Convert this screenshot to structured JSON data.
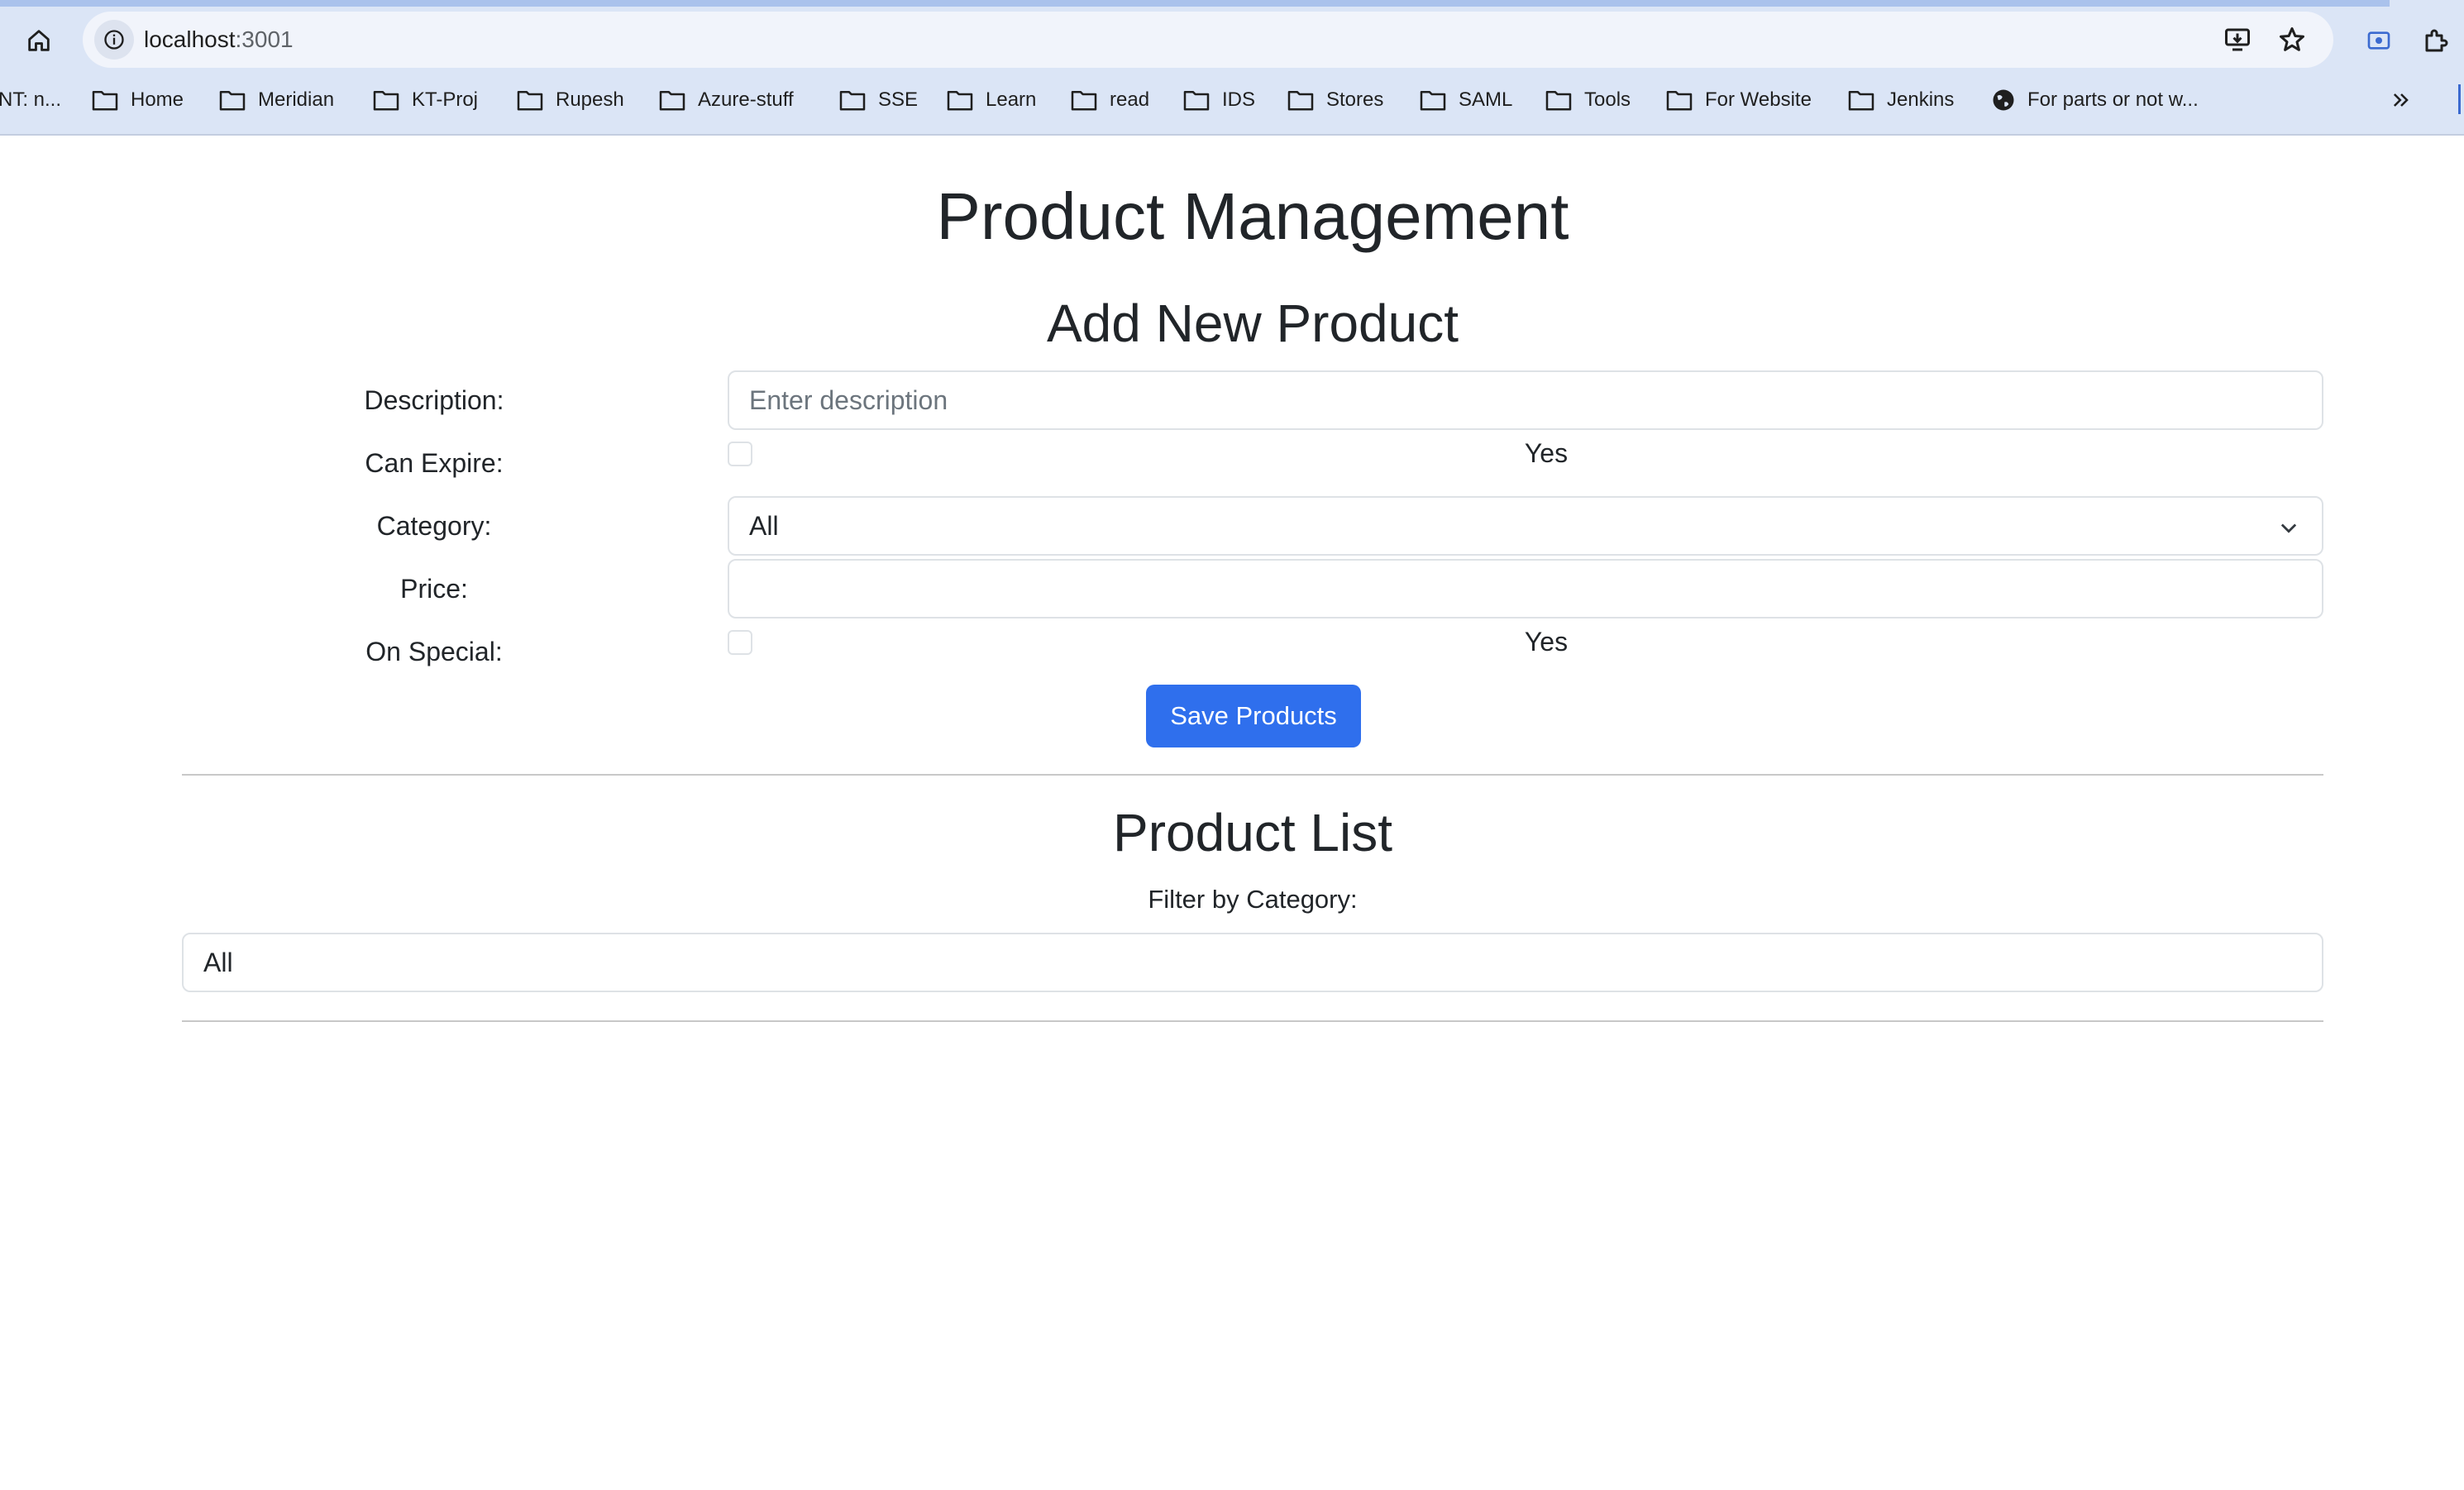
{
  "browser": {
    "url_host": "localhost",
    "url_port": ":3001",
    "bookmarks": [
      {
        "label": "NT: n...",
        "icon": "folder-icon"
      },
      {
        "label": "Home",
        "icon": "folder-icon"
      },
      {
        "label": "Meridian",
        "icon": "folder-icon"
      },
      {
        "label": "KT-Proj",
        "icon": "folder-icon"
      },
      {
        "label": "Rupesh",
        "icon": "folder-icon"
      },
      {
        "label": "Azure-stuff",
        "icon": "folder-icon"
      },
      {
        "label": "SSE",
        "icon": "folder-icon"
      },
      {
        "label": "Learn",
        "icon": "folder-icon"
      },
      {
        "label": "read",
        "icon": "folder-icon"
      },
      {
        "label": "IDS",
        "icon": "folder-icon"
      },
      {
        "label": "Stores",
        "icon": "folder-icon"
      },
      {
        "label": "SAML",
        "icon": "folder-icon"
      },
      {
        "label": "Tools",
        "icon": "folder-icon"
      },
      {
        "label": "For Website",
        "icon": "folder-icon"
      },
      {
        "label": "Jenkins",
        "icon": "folder-icon"
      },
      {
        "label": "For parts or not w...",
        "icon": "globe-icon"
      }
    ]
  },
  "page": {
    "title": "Product Management",
    "add_section_title": "Add New Product",
    "form": {
      "description_label": "Description:",
      "description_placeholder": "Enter description",
      "description_value": "",
      "can_expire_label": "Can Expire:",
      "can_expire_option": "Yes",
      "can_expire_checked": false,
      "category_label": "Category:",
      "category_value": "All",
      "price_label": "Price:",
      "price_value": "",
      "on_special_label": "On Special:",
      "on_special_option": "Yes",
      "on_special_checked": false,
      "save_button": "Save Products"
    },
    "list_section_title": "Product List",
    "filter_label": "Filter by Category:",
    "filter_value": "All"
  },
  "colors": {
    "primary_button": "#2f6fed",
    "chrome_background": "#dbe5f6"
  }
}
